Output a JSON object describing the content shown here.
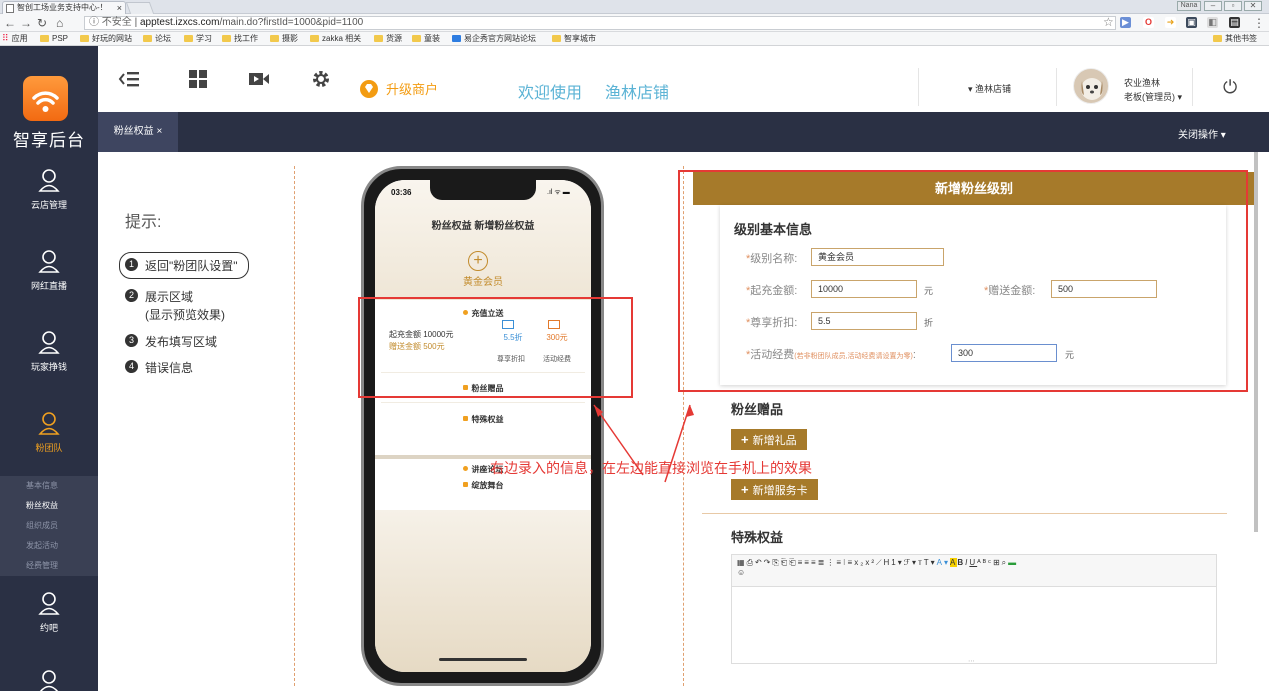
{
  "browser": {
    "tab_title": "智创工场业务支持中心-！",
    "user_chip": "Nana",
    "security_label": "不安全",
    "url_host": "apptest.izxcs.com",
    "url_path": "/main.do?firstId=1000&pid=1100",
    "bookmarks": [
      "应用",
      "PSP",
      "好玩的网站",
      "论坛",
      "学习",
      "找工作",
      "摄影",
      "zakka 相关",
      "货源",
      "童装",
      "易企秀官方网站论坛",
      "智享城市"
    ],
    "other_bookmarks": "其他书签"
  },
  "sidebar": {
    "logo_text": "智享后台",
    "items": [
      {
        "label": "云店管理",
        "icon": "user-icon"
      },
      {
        "label": "网红直播",
        "icon": "user-icon"
      },
      {
        "label": "玩家挣钱",
        "icon": "user-icon"
      },
      {
        "label": "粉团队",
        "icon": "user-icon"
      },
      {
        "label": "约吧",
        "icon": "user-icon"
      }
    ],
    "submenu": [
      "基本信息",
      "粉丝权益",
      "组织成员",
      "发起活动",
      "经费管理"
    ]
  },
  "header": {
    "upgrade_label": "升级商户",
    "welcome": "欢迎使用",
    "store_name": "渔林店铺",
    "store_dropdown": "▾ 渔林店铺",
    "user_name": "农业渔林",
    "user_role": "老板(管理员) ▾"
  },
  "tabs": {
    "active_tab": "粉丝权益 ×",
    "close_ops": "关闭操作 ▾"
  },
  "tips": {
    "title": "提示:",
    "steps": [
      {
        "num": "1",
        "text": "返回\"粉团队设置\""
      },
      {
        "num": "2",
        "text": "展示区域",
        "sub": "(显示预览效果)"
      },
      {
        "num": "3",
        "text": "发布填写区域"
      },
      {
        "num": "4",
        "text": "错误信息"
      }
    ]
  },
  "phone": {
    "time": "03:36",
    "status": ".ıl ᯤ ▬",
    "title": "粉丝权益 新增粉丝权益",
    "tier": "黄金会员",
    "recharge_title": "充值立送",
    "start_amount": "起充金额 10000元",
    "gift_amount": "赠送金额 500元",
    "discount_value": "5.5折",
    "discount_label": "尊享折扣",
    "fund_value": "300元",
    "fund_label": "活动经费",
    "gifts_title": "粉丝赠品",
    "special_title": "特殊权益",
    "lecture_title": "讲座论坛",
    "stage_title": "绽放舞台"
  },
  "form": {
    "header": "新增粉丝级别",
    "basic_title": "级别基本信息",
    "level_name_label": "级别名称:",
    "level_name_value": "黄金会员",
    "start_amount_label": "起充金额:",
    "start_amount_value": "10000",
    "start_amount_unit": "元",
    "gift_amount_label": "赠送金额:",
    "gift_amount_value": "500",
    "discount_label": "尊享折扣:",
    "discount_value": "5.5",
    "discount_unit": "折",
    "fund_label": "活动经费",
    "fund_hint": "(若非粉团队成员,活动经费请设置为零)",
    "fund_colon": ":",
    "fund_value": "300",
    "fund_unit": "元",
    "gifts_title": "粉丝赠品",
    "add_gift": "新增礼品",
    "add_service_card": "新增服务卡",
    "special_title": "特殊权益"
  },
  "annotation": {
    "text": "右边录入的信息，在左边能直接浏览在手机上的效果",
    "color": "#e53935"
  },
  "colors": {
    "sidebar_bg": "#2a3044",
    "brand_brown": "#a67a2a",
    "accent_orange": "#f39c12",
    "welcome_blue": "#5bb3d5"
  }
}
